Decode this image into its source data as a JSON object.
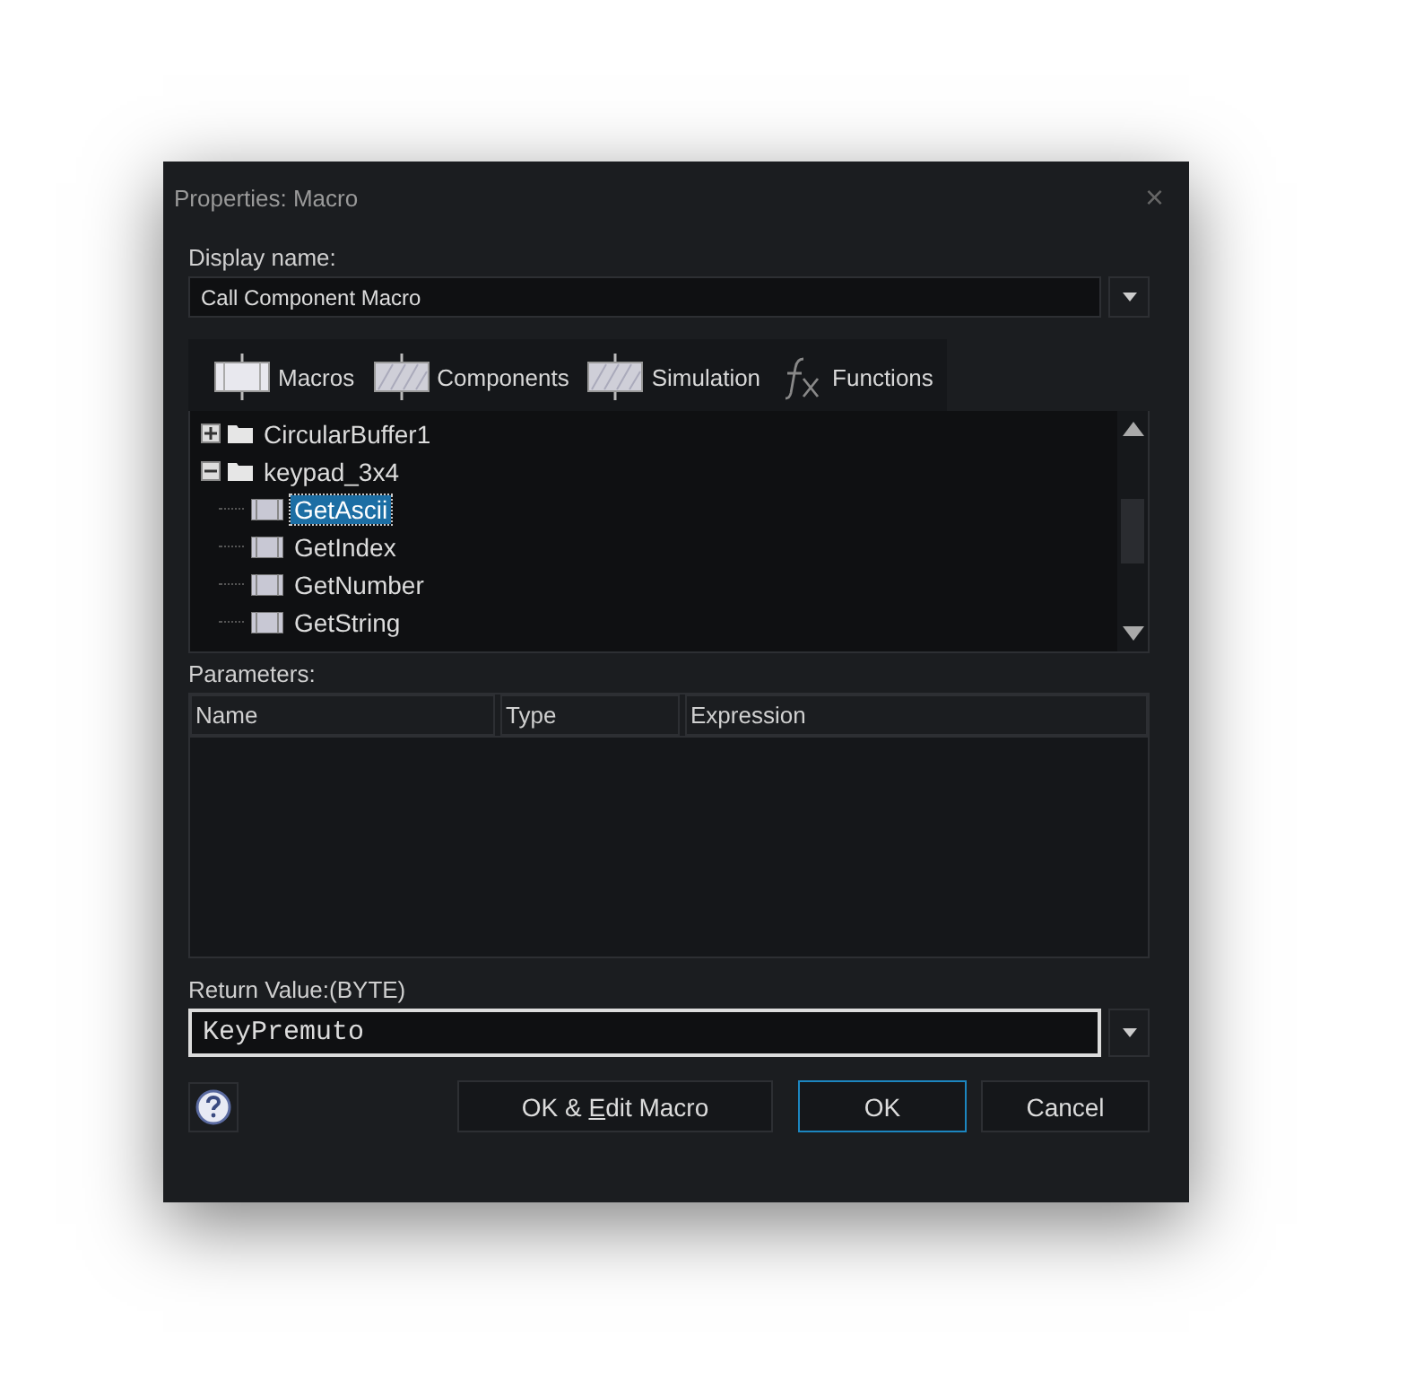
{
  "window": {
    "title": "Properties: Macro",
    "close": "×"
  },
  "display_name": {
    "label": "Display name:",
    "value": "Call Component Macro"
  },
  "tabs": [
    {
      "label": "Macros",
      "kind": "macro"
    },
    {
      "label": "Components",
      "kind": "component"
    },
    {
      "label": "Simulation",
      "kind": "simulation"
    },
    {
      "label": "Functions",
      "kind": "function"
    }
  ],
  "tree": [
    {
      "label": "CircularBuffer1",
      "expanded": false,
      "selected": false
    },
    {
      "label": "keypad_3x4",
      "expanded": true,
      "selected": false,
      "children": [
        {
          "label": "GetAscii",
          "selected": true
        },
        {
          "label": "GetIndex",
          "selected": false
        },
        {
          "label": "GetNumber",
          "selected": false
        },
        {
          "label": "GetString",
          "selected": false
        }
      ]
    }
  ],
  "parameters": {
    "label": "Parameters:",
    "columns": [
      "Name",
      "Type",
      "Expression"
    ]
  },
  "return_value": {
    "label": "Return Value:(BYTE)",
    "value": "KeyPremuto"
  },
  "buttons": [
    {
      "kind": "mnemonic",
      "before": "OK & ",
      "mnemonic": "E",
      "after": "dit Macro",
      "default": false
    },
    {
      "kind": "plain",
      "label": "OK",
      "default": true
    },
    {
      "kind": "plain",
      "label": "Cancel",
      "default": false
    }
  ]
}
